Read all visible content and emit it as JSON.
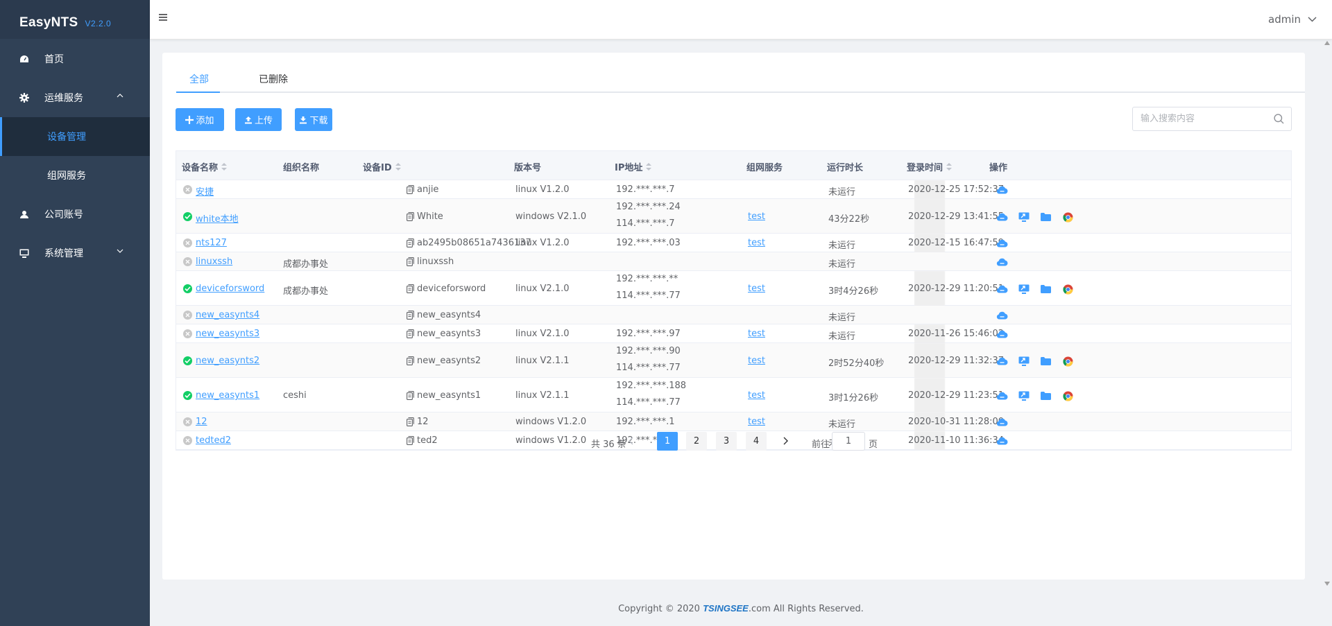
{
  "app": {
    "name": "EasyNTS",
    "version": "V2.2.0"
  },
  "sidebar": {
    "items": [
      {
        "label": "首页",
        "icon": "dashboard-icon"
      },
      {
        "label": "运维服务",
        "icon": "gear-icon",
        "expanded": true,
        "children": [
          {
            "label": "设备管理",
            "active": true
          },
          {
            "label": "组网服务"
          }
        ]
      },
      {
        "label": "公司账号",
        "icon": "user-icon"
      },
      {
        "label": "系统管理",
        "icon": "monitor-icon",
        "expanded": false
      }
    ]
  },
  "topbar": {
    "user": "admin"
  },
  "tabs": [
    {
      "label": "全部",
      "active": true
    },
    {
      "label": "已删除"
    }
  ],
  "toolbar": {
    "add": "添加",
    "upload": "上传",
    "download": "下载",
    "search_placeholder": "输入搜索内容"
  },
  "table": {
    "headers": [
      "设备名称",
      "组织名称",
      "设备ID",
      "版本号",
      "IP地址",
      "组网服务",
      "运行时长",
      "登录时间",
      "操作"
    ],
    "rows": [
      {
        "online": false,
        "name": "安捷",
        "org": "",
        "id": "anjie",
        "version": "linux V1.2.0",
        "ip": [
          "192.***.***.7"
        ],
        "service": "",
        "uptime": "未运行",
        "login": "2020-12-25 17:52:37"
      },
      {
        "online": true,
        "name": "white本地",
        "org": "",
        "id": "White",
        "version": "windows V2.1.0",
        "ip": [
          "192.***.***.24",
          "114.***.***.7"
        ],
        "service": "test",
        "uptime": "43分22秒",
        "login": "2020-12-29 13:41:55"
      },
      {
        "online": false,
        "name": "nts127",
        "org": "",
        "id": "ab2495b08651a7436137",
        "version": "linux V1.2.0",
        "ip": [
          "192.***.***.03"
        ],
        "service": "test",
        "uptime": "未运行",
        "login": "2020-12-15 16:47:59"
      },
      {
        "online": false,
        "name": "linuxssh",
        "org": "成都办事处",
        "id": "linuxssh",
        "version": "",
        "ip": [],
        "service": "",
        "uptime": "未运行",
        "login": ""
      },
      {
        "online": true,
        "name": "deviceforsword",
        "org": "成都办事处",
        "id": "deviceforsword",
        "version": "linux V2.1.0",
        "ip": [
          "192.***.***.**",
          "114.***.***.77"
        ],
        "service": "test",
        "uptime": "3时4分26秒",
        "login": "2020-12-29 11:20:51"
      },
      {
        "online": false,
        "name": "new_easynts4",
        "org": "",
        "id": "new_easynts4",
        "version": "",
        "ip": [],
        "service": "",
        "uptime": "未运行",
        "login": ""
      },
      {
        "online": false,
        "name": "new_easynts3",
        "org": "",
        "id": "new_easynts3",
        "version": "linux V2.1.0",
        "ip": [
          "192.***.***.97"
        ],
        "service": "test",
        "uptime": "未运行",
        "login": "2020-11-26 15:46:02"
      },
      {
        "online": true,
        "name": "new_easynts2",
        "org": "",
        "id": "new_easynts2",
        "version": "linux V2.1.1",
        "ip": [
          "192.***.***.90",
          "114.***.***.77"
        ],
        "service": "test",
        "uptime": "2时52分40秒",
        "login": "2020-12-29 11:32:37"
      },
      {
        "online": true,
        "name": "new_easynts1",
        "org": "ceshi",
        "id": "new_easynts1",
        "version": "linux V2.1.1",
        "ip": [
          "192.***.***.188",
          "114.***.***.77"
        ],
        "service": "test",
        "uptime": "3时1分26秒",
        "login": "2020-12-29 11:23:51"
      },
      {
        "online": false,
        "name": "12",
        "org": "",
        "id": "12",
        "version": "windows V1.2.0",
        "ip": [
          "192.***.***.1"
        ],
        "service": "test",
        "uptime": "未运行",
        "login": "2020-10-31 11:28:00"
      },
      {
        "online": false,
        "name": "tedted2",
        "org": "",
        "id": "ted2",
        "version": "windows V1.2.0",
        "ip": [
          "192.***.***.1"
        ],
        "service": "test",
        "uptime": "未运行",
        "login": "2020-11-10 11:36:34"
      }
    ]
  },
  "pagination": {
    "total": "共 36 条",
    "pages": [
      "1",
      "2",
      "3",
      "4"
    ],
    "current": "1",
    "goto_prefix": "前往",
    "goto_suffix": "页",
    "goto_value": "1"
  },
  "footer": {
    "prefix": "Copyright © 2020 ",
    "brand": "TSINGSEE",
    "suffix": ".com All Rights Reserved."
  },
  "colors": {
    "primary": "#409eff",
    "sidebar": "#304156",
    "online": "#13ce66",
    "offline": "#c8c8c8"
  }
}
